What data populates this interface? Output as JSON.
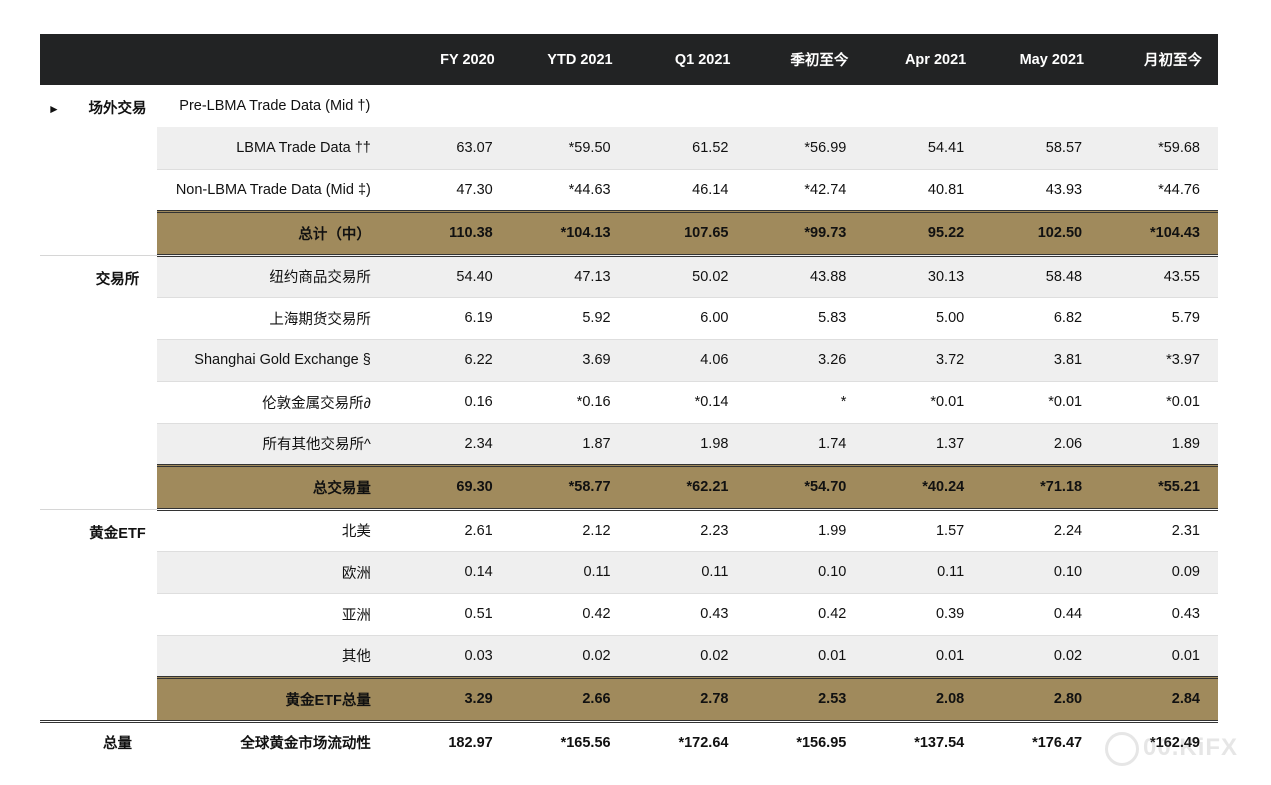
{
  "header": [
    "FY 2020",
    "YTD 2021",
    "Q1 2021",
    "季初至今",
    "Apr 2021",
    "May 2021",
    "月初至今"
  ],
  "sections": {
    "otc": {
      "arrow": "►",
      "label": "场外交易"
    },
    "exchanges": {
      "label": "交易所"
    },
    "etf": {
      "label": "黄金ETF"
    },
    "grand": {
      "label": "总量"
    }
  },
  "rows": [
    {
      "label": "Pre-LBMA Trade Data (Mid †)",
      "values": [
        "",
        "",
        "",
        "",
        "",
        "",
        ""
      ]
    },
    {
      "label": "LBMA Trade Data ††",
      "values": [
        "63.07",
        "*59.50",
        "61.52",
        "*56.99",
        "54.41",
        "58.57",
        "*59.68"
      ]
    },
    {
      "label": "Non-LBMA Trade Data (Mid ‡)",
      "values": [
        "47.30",
        "*44.63",
        "46.14",
        "*42.74",
        "40.81",
        "43.93",
        "*44.76"
      ]
    },
    {
      "label": "总计（中）",
      "values": [
        "110.38",
        "*104.13",
        "107.65",
        "*99.73",
        "95.22",
        "102.50",
        "*104.43"
      ]
    },
    {
      "label": "纽约商品交易所",
      "values": [
        "54.40",
        "47.13",
        "50.02",
        "43.88",
        "30.13",
        "58.48",
        "43.55"
      ]
    },
    {
      "label": "上海期货交易所",
      "values": [
        "6.19",
        "5.92",
        "6.00",
        "5.83",
        "5.00",
        "6.82",
        "5.79"
      ]
    },
    {
      "label": "Shanghai Gold Exchange §",
      "values": [
        "6.22",
        "3.69",
        "4.06",
        "3.26",
        "3.72",
        "3.81",
        "*3.97"
      ]
    },
    {
      "label": "伦敦金属交易所∂",
      "values": [
        "0.16",
        "*0.16",
        "*0.14",
        "*",
        "*0.01",
        "*0.01",
        "*0.01"
      ]
    },
    {
      "label": "所有其他交易所^",
      "values": [
        "2.34",
        "1.87",
        "1.98",
        "1.74",
        "1.37",
        "2.06",
        "1.89"
      ]
    },
    {
      "label": "总交易量",
      "values": [
        "69.30",
        "*58.77",
        "*62.21",
        "*54.70",
        "*40.24",
        "*71.18",
        "*55.21"
      ]
    },
    {
      "label": "北美",
      "values": [
        "2.61",
        "2.12",
        "2.23",
        "1.99",
        "1.57",
        "2.24",
        "2.31"
      ]
    },
    {
      "label": "欧洲",
      "values": [
        "0.14",
        "0.11",
        "0.11",
        "0.10",
        "0.11",
        "0.10",
        "0.09"
      ]
    },
    {
      "label": "亚洲",
      "values": [
        "0.51",
        "0.42",
        "0.43",
        "0.42",
        "0.39",
        "0.44",
        "0.43"
      ]
    },
    {
      "label": "其他",
      "values": [
        "0.03",
        "0.02",
        "0.02",
        "0.01",
        "0.01",
        "0.02",
        "0.01"
      ]
    },
    {
      "label": "黄金ETF总量",
      "values": [
        "3.29",
        "2.66",
        "2.78",
        "2.53",
        "2.08",
        "2.80",
        "2.84"
      ]
    },
    {
      "label": "全球黄金市场流动性",
      "values": [
        "182.97",
        "*165.56",
        "*172.64",
        "*156.95",
        "*137.54",
        "*176.47",
        "*162.49"
      ]
    }
  ],
  "watermark": "00.KiFX",
  "colors": {
    "header_bg": "#222324",
    "total_bg": "#a08a5c",
    "shade_bg": "#efefef"
  }
}
